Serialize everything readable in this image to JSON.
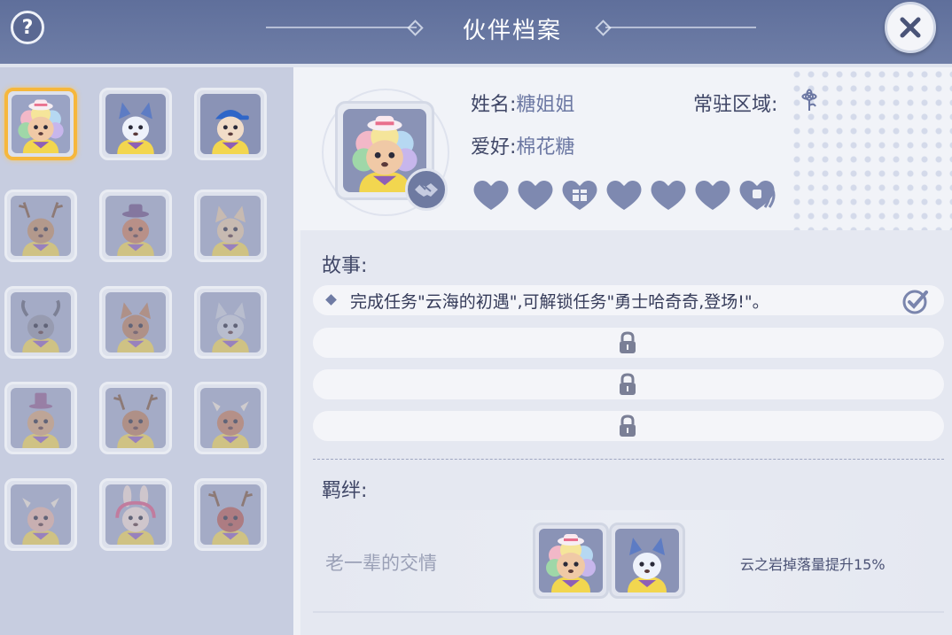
{
  "header": {
    "title": "伙伴档案",
    "help_label": "?"
  },
  "roster": [
    {
      "id": "tangjiejie",
      "icon": "sheep-with-hat",
      "selected": true,
      "unlocked": true
    },
    {
      "id": "wolf",
      "icon": "blue-wolf",
      "selected": false,
      "unlocked": true
    },
    {
      "id": "cap-boy",
      "icon": "boy-blue-cap",
      "selected": false,
      "unlocked": true
    },
    {
      "id": "deer",
      "icon": "deer",
      "selected": false,
      "unlocked": false
    },
    {
      "id": "fox-hat",
      "icon": "fox-with-hat",
      "selected": false,
      "unlocked": false
    },
    {
      "id": "cat",
      "icon": "cat",
      "selected": false,
      "unlocked": false
    },
    {
      "id": "goat",
      "icon": "goat",
      "selected": false,
      "unlocked": false
    },
    {
      "id": "squirrel",
      "icon": "squirrel",
      "selected": false,
      "unlocked": false
    },
    {
      "id": "cat2",
      "icon": "grey-cat",
      "selected": false,
      "unlocked": false
    },
    {
      "id": "bear-hat",
      "icon": "bear-top-hat",
      "selected": false,
      "unlocked": false
    },
    {
      "id": "moose",
      "icon": "moose",
      "selected": false,
      "unlocked": false
    },
    {
      "id": "cow",
      "icon": "cow",
      "selected": false,
      "unlocked": false
    },
    {
      "id": "pig",
      "icon": "pig",
      "selected": false,
      "unlocked": false
    },
    {
      "id": "bunny-headphones",
      "icon": "rabbit-headphones",
      "selected": false,
      "unlocked": false
    },
    {
      "id": "reindeer",
      "icon": "reindeer",
      "selected": false,
      "unlocked": false
    }
  ],
  "profile": {
    "name_label": "姓名:",
    "name_value": "糖姐姐",
    "hobby_label": "爱好:",
    "hobby_value": "棉花糖",
    "region_label": "常驻区域:",
    "region_icon": "flower-region-icon",
    "badge_icon": "handshake-icon",
    "hearts": [
      "heart",
      "heart",
      "gift-heart",
      "heart",
      "heart",
      "heart",
      "lock-heart"
    ]
  },
  "story": {
    "title": "故事:",
    "entries": [
      {
        "text": "完成任务\"云海的初遇\",可解锁任务\"勇士哈奇奇,登场!\"。",
        "unlocked": true,
        "completed": true
      },
      {
        "text": "",
        "unlocked": false,
        "completed": false
      },
      {
        "text": "",
        "unlocked": false,
        "completed": false
      },
      {
        "text": "",
        "unlocked": false,
        "completed": false
      }
    ]
  },
  "bond": {
    "title": "羁绊:",
    "name": "老一辈的交情",
    "effect": "云之岩掉落量提升15%",
    "members": [
      "sheep-with-hat",
      "blue-wolf"
    ]
  },
  "colors": {
    "header": "#5f6f9b",
    "accent_selected": "#f6b73c",
    "heart": "#7e89b0",
    "text_value": "#6c78a3"
  }
}
